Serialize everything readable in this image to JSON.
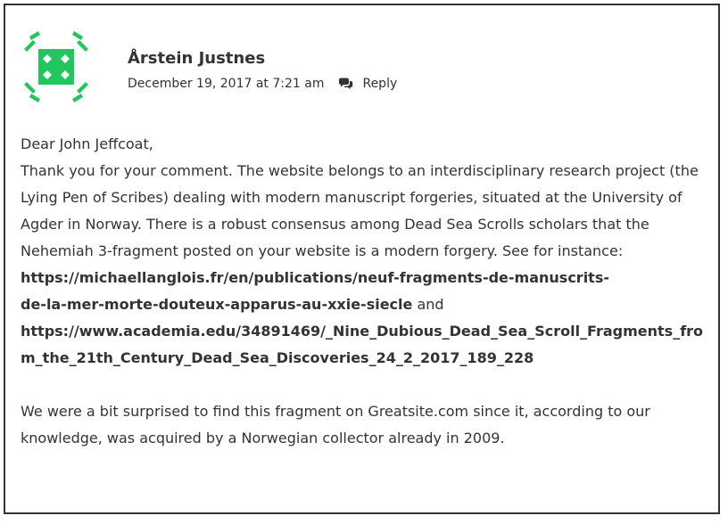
{
  "comment": {
    "author": "Årstein Justnes",
    "date": "December 19, 2017 at 7:21 am",
    "reply_label": "Reply",
    "avatar": {
      "icon": "identicon",
      "color": "#22c55e"
    },
    "body": {
      "greeting": "Dear John Jeffcoat,",
      "intro": "Thank you for your comment. The website belongs to an interdisciplinary research project (the Lying Pen of Scribes) dealing with modern manuscript forgeries, situated at the University of Agder in Norway. There is a robust consensus among Dead Sea Scrolls scholars that the Nehemiah 3-fragment posted on your website is a modern forgery. See for instance:",
      "link1_line1": "https://michaellanglois.fr/en/publications/neuf-fragments-de-manuscrits-",
      "link1_line2": "de-la-mer-morte-douteux-apparus-au-xxie-siecle",
      "and_word": "and",
      "link2": "https://www.academia.edu/34891469/_Nine_Dubious_Dead_Sea_Scroll_Fragments_from_the_21th_Century_Dead_Sea_Discoveries_24_2_2017_189_228",
      "closing": "We were a bit surprised to find this fragment on Greatsite.com since it, according to our knowledge, was acquired by a Norwegian collector already in 2009."
    }
  }
}
